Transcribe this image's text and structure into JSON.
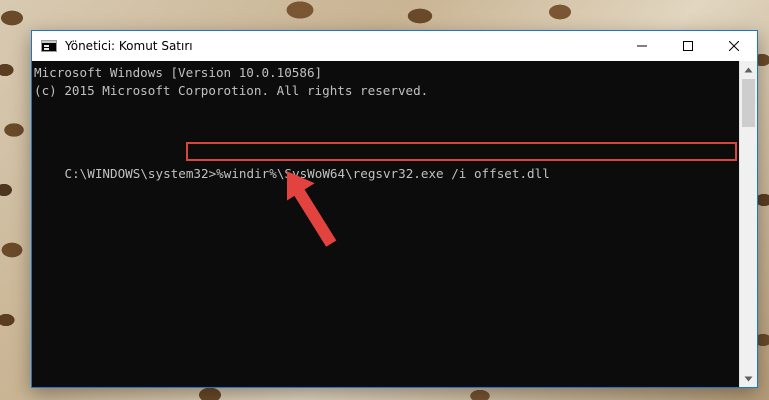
{
  "window": {
    "title": "Yönetici: Komut Satırı",
    "minimize_icon": "minimize-icon",
    "maximize_icon": "maximize-icon",
    "close_icon": "close-icon"
  },
  "console": {
    "lines": [
      "Microsoft Windows [Version 10.0.10586]",
      "(c) 2015 Microsoft Corporotion. All rights reserved."
    ],
    "prompt": "C:\\WINDOWS\\system32>",
    "command": "%windir%\\SysWoW64\\regsvr32.exe /i offset.dll",
    "text_color": "#c0c0c0",
    "background": "#0c0c0c"
  },
  "annotation": {
    "highlight_color": "#d9443b",
    "arrow_icon": "red-arrow-icon"
  }
}
